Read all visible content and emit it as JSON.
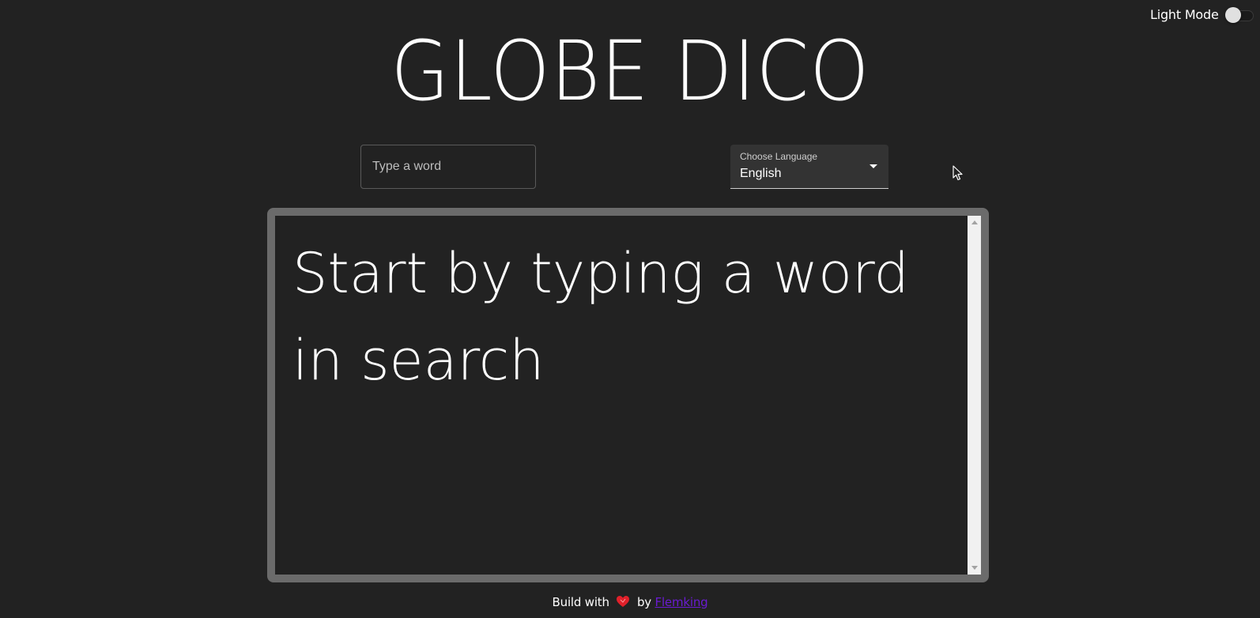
{
  "theme_toggle": {
    "label": "Light Mode",
    "checked": false
  },
  "header": {
    "title": "GLOBE DICO"
  },
  "search": {
    "placeholder": "Type a word",
    "value": ""
  },
  "language_select": {
    "label": "Choose Language",
    "selected": "English"
  },
  "result": {
    "message": "Start by typing a word in search"
  },
  "footer": {
    "prefix": "Build with",
    "by": "by",
    "author_link": "Flemking"
  },
  "colors": {
    "background": "#222222",
    "panel_frame": "#6b6b6b",
    "select_bg": "#333333",
    "link": "#6a1bd1",
    "heart": "#e0202a"
  },
  "icons": {
    "heart": "heart-icon",
    "caret": "caret-down-icon",
    "cursor": "mouse-cursor-icon"
  }
}
